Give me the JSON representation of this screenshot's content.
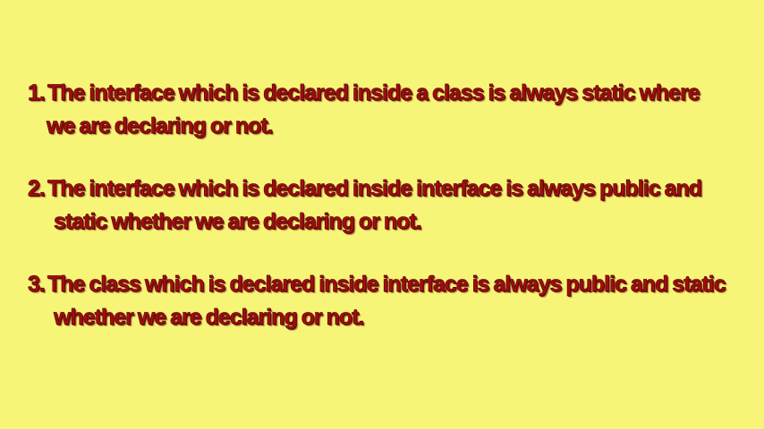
{
  "slide": {
    "background_color": "#f7f577",
    "text_color": "#a30d0d",
    "points": [
      {
        "number": "1.",
        "line1": "The interface which is declared inside a class is always static where",
        "line2": "we are declaring or not."
      },
      {
        "number": "2.",
        "line1": "The interface which is declared inside interface is always public and",
        "line2": "static whether we are declaring or not."
      },
      {
        "number": "3.",
        "line1": "The class which is declared inside interface is always public and static",
        "line2": "whether we are declaring or not."
      }
    ]
  }
}
